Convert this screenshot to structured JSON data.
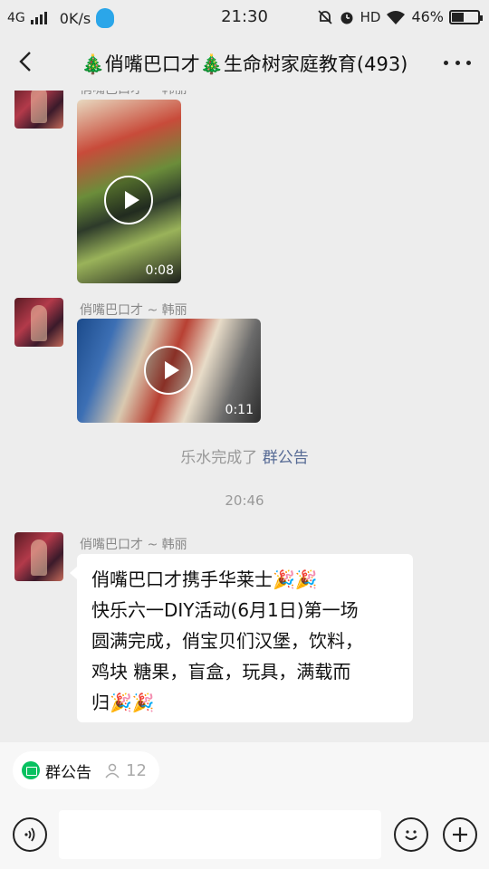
{
  "status_bar": {
    "network": "4G",
    "speed": "0K/s",
    "time": "21:30",
    "hd": "HD",
    "battery": "46%",
    "battery_level": 0.46
  },
  "header": {
    "title": "🎄俏嘴巴口才🎄生命树家庭教育(493)"
  },
  "messages": [
    {
      "sender": "俏嘴巴口才 ~ 韩丽",
      "type": "video",
      "duration": "0:08"
    },
    {
      "sender": "俏嘴巴口才 ~ 韩丽",
      "type": "video",
      "duration": "0:11"
    }
  ],
  "system_notice": {
    "text": "乐水完成了 ",
    "link": "群公告"
  },
  "timestamp": "20:46",
  "text_message": {
    "sender": "俏嘴巴口才 ~ 韩丽",
    "lines": [
      "俏嘴巴口才携手华莱士🎉🎉",
      "快乐六一DIY活动(6月1日)第一场",
      "圆满完成，俏宝贝们汉堡，饮料，",
      "鸡块 糖果，盲盒，玩具，满载而",
      "归🎉🎉"
    ]
  },
  "notice_chip": {
    "label": "群公告",
    "count": "12"
  },
  "input": {
    "placeholder": ""
  },
  "icons": {
    "back": "back-arrow-icon",
    "more": "more-dots-icon",
    "voice": "voice-icon",
    "emoji": "emoji-icon",
    "plus": "plus-icon",
    "play": "play-icon"
  }
}
